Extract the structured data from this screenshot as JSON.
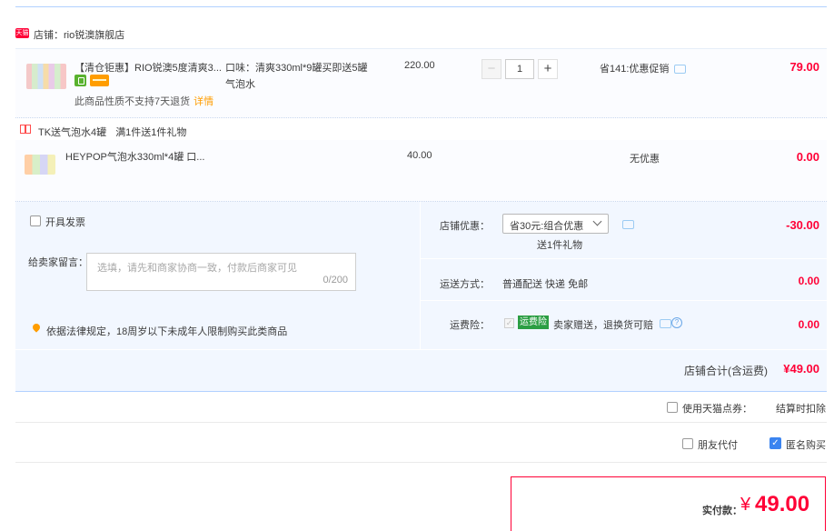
{
  "shop": {
    "badge": "天猫",
    "label": "店铺：rio锐澳旗舰店"
  },
  "item1": {
    "title": "【清仓钜惠】RIO锐澳5度清爽3...",
    "attribute": "口味：清爽330ml*9罐买即送5罐气泡水",
    "price": "220.00",
    "quantity": "1",
    "minus_symbol": "−",
    "plus_symbol": "+",
    "promo": "省141:优惠促销",
    "return_note": "此商品性质不支持7天退货",
    "detail_link": "详情",
    "subtotal": "79.00"
  },
  "gift": {
    "title": "TK送气泡水4罐",
    "subtitle": "满1件送1件礼物"
  },
  "item2": {
    "title": "HEYPOP气泡水330ml*4罐 口...",
    "price": "40.00",
    "promo": "无优惠",
    "subtotal": "0.00"
  },
  "invoice": {
    "label": "开具发票"
  },
  "message": {
    "label": "给卖家留言：",
    "placeholder": "选填，请先和商家协商一致，付款后商家可见",
    "count": "0/200"
  },
  "law_note": "依据法律规定，18周岁以下未成年人限制购买此类商品",
  "shop_discount": {
    "label": "店铺优惠：",
    "selected": "省30元:组合优惠",
    "gift_note": "送1件礼物",
    "amount": "-30.00"
  },
  "shipping": {
    "label": "运送方式：",
    "value": "普通配送 快递 免邮",
    "amount": "0.00"
  },
  "insurance": {
    "label": "运费险：",
    "check": "✓",
    "badge": "运费险",
    "text": "卖家赠送，退换货可赔",
    "help": "?",
    "amount": "0.00"
  },
  "shop_total": {
    "label": "店铺合计(含运费)",
    "amount": "¥49.00"
  },
  "options": {
    "coupon_label": "使用天猫点券：",
    "coupon_note": "结算时扣除",
    "friend_pay": "朋友代付",
    "anonymous": "匿名购买",
    "anon_check": "✓"
  },
  "payment": {
    "label": "实付款：",
    "currency": "¥",
    "amount": "49.00"
  },
  "colors": {
    "accent_red": "#ff0036",
    "panel_bg": "#f2f7ff",
    "check_blue": "#3b84f0",
    "insurance_green": "#2b9e43"
  }
}
